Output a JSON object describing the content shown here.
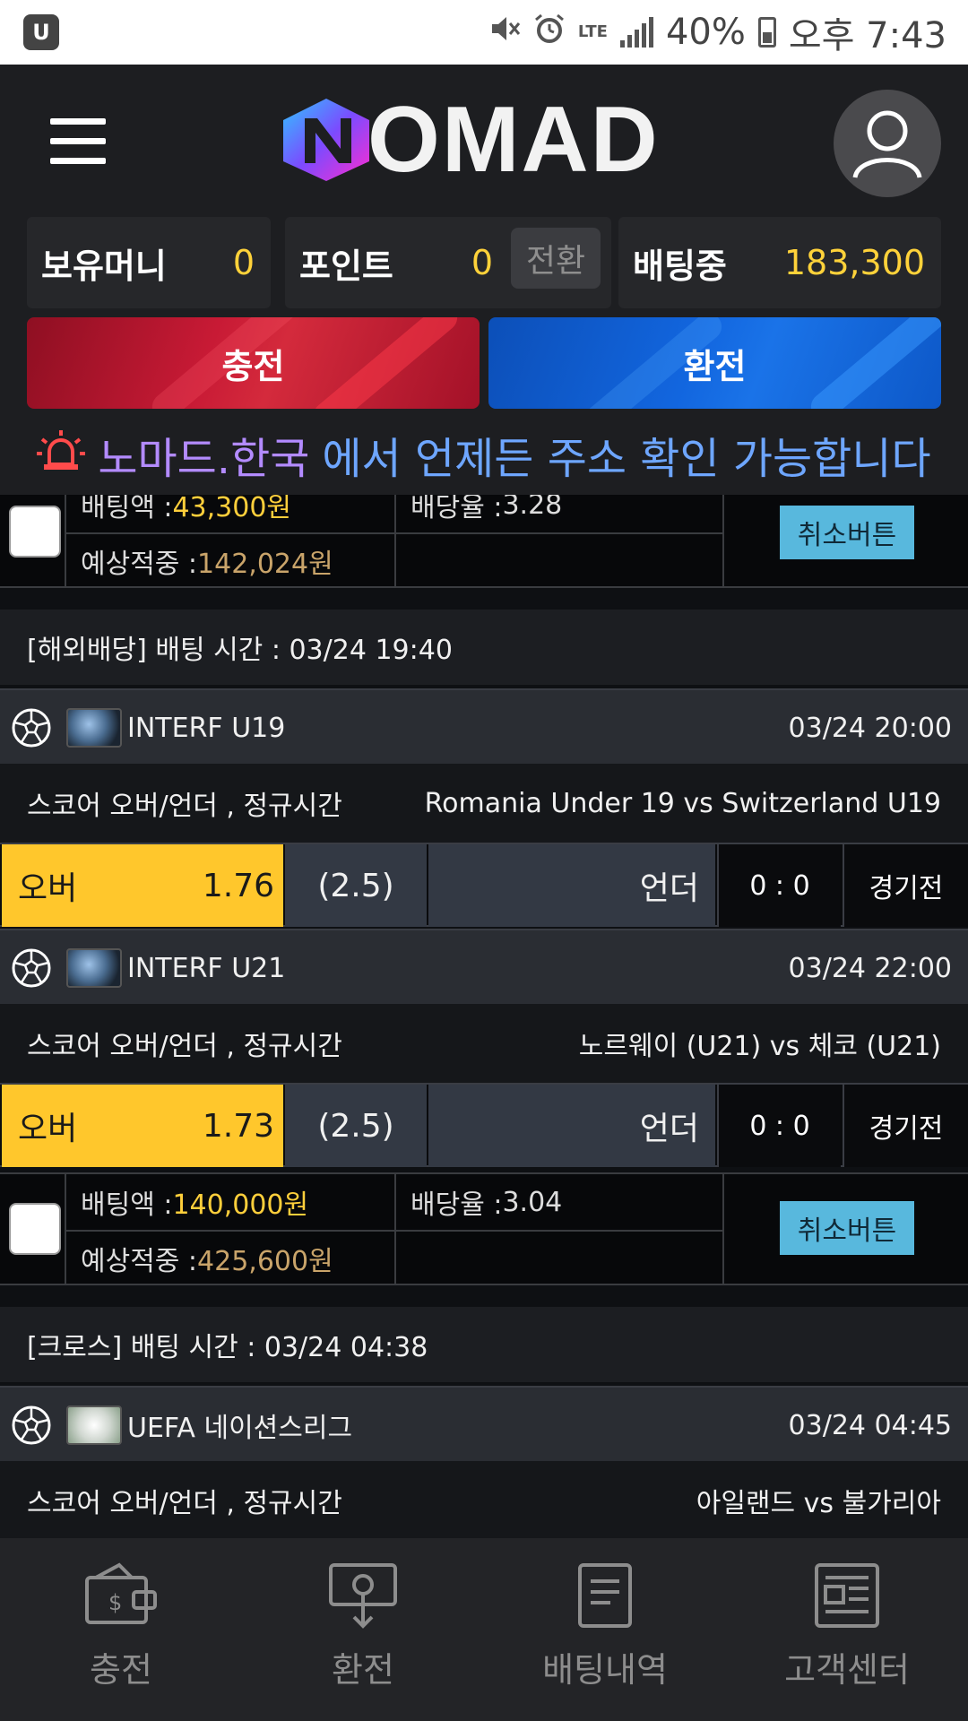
{
  "status_bar": {
    "app_icon": "U",
    "battery": "40%",
    "time": "오후 7:43",
    "network": "LTE",
    "icons": [
      "mute-icon",
      "alarm-icon",
      "lte-icon",
      "signal-icon",
      "battery-icon"
    ]
  },
  "header": {
    "logo_text": "OMAD",
    "menu_icon": "hamburger-icon",
    "profile_icon": "user-icon"
  },
  "balances": {
    "money_label": "보유머니",
    "money_value": "0",
    "point_label": "포인트",
    "point_value": "0",
    "convert_label": "전환",
    "betting_label": "배팅중",
    "betting_value": "183,300"
  },
  "actions": {
    "charge": "충전",
    "exchange": "환전"
  },
  "notice": {
    "highlight": "노마드.한국",
    "text": "에서 언제든 주소 확인 가능합니다"
  },
  "bets": [
    {
      "amount_label": "배팅액 : ",
      "amount": "43,300원",
      "odds_label": "배당율 : ",
      "odds": "3.28",
      "expected_label": "예상적중 : ",
      "expected": "142,024원",
      "cancel": "취소버튼"
    },
    {
      "amount_label": "배팅액 : ",
      "amount": "140,000원",
      "odds_label": "배당율 : ",
      "odds": "3.04",
      "expected_label": "예상적중 : ",
      "expected": "425,600원",
      "cancel": "취소버튼"
    }
  ],
  "sections": [
    {
      "bet_time": "[해외배당] 배팅 시간 : 03/24 19:40",
      "games": [
        {
          "league": "INTERF U19",
          "time": "03/24 20:00",
          "market": "스코어 오버/언더 , 정규시간",
          "teams": "Romania Under 19  vs  Switzerland U19",
          "over_label": "오버",
          "over_odds": "1.76",
          "handicap": "(2.5)",
          "under_label": "언더",
          "score": "0 : 0",
          "status": "경기전"
        },
        {
          "league": "INTERF U21",
          "time": "03/24 22:00",
          "market": "스코어 오버/언더 , 정규시간",
          "teams": "노르웨이 (U21)  vs  체코 (U21)",
          "over_label": "오버",
          "over_odds": "1.73",
          "handicap": "(2.5)",
          "under_label": "언더",
          "score": "0 : 0",
          "status": "경기전"
        }
      ]
    },
    {
      "bet_time": "[크로스] 배팅 시간 : 03/24 04:38",
      "games": [
        {
          "league": "UEFA 네이션스리그",
          "time": "03/24 04:45",
          "market": "스코어 오버/언더 , 정규시간",
          "teams": "아일랜드  vs  불가리아"
        }
      ]
    }
  ],
  "bottom_nav": [
    {
      "label": "충전",
      "icon": "wallet-icon"
    },
    {
      "label": "환전",
      "icon": "withdraw-icon"
    },
    {
      "label": "배팅내역",
      "icon": "document-icon"
    },
    {
      "label": "고객센터",
      "icon": "newspaper-icon"
    }
  ],
  "colors": {
    "accent_yellow": "#ffc72c",
    "charge_red": "#c81a35",
    "exchange_blue": "#1266df",
    "cancel_blue": "#58b8dd",
    "notice_purple": "#b38bff",
    "notice_blue": "#6ea6ff"
  }
}
